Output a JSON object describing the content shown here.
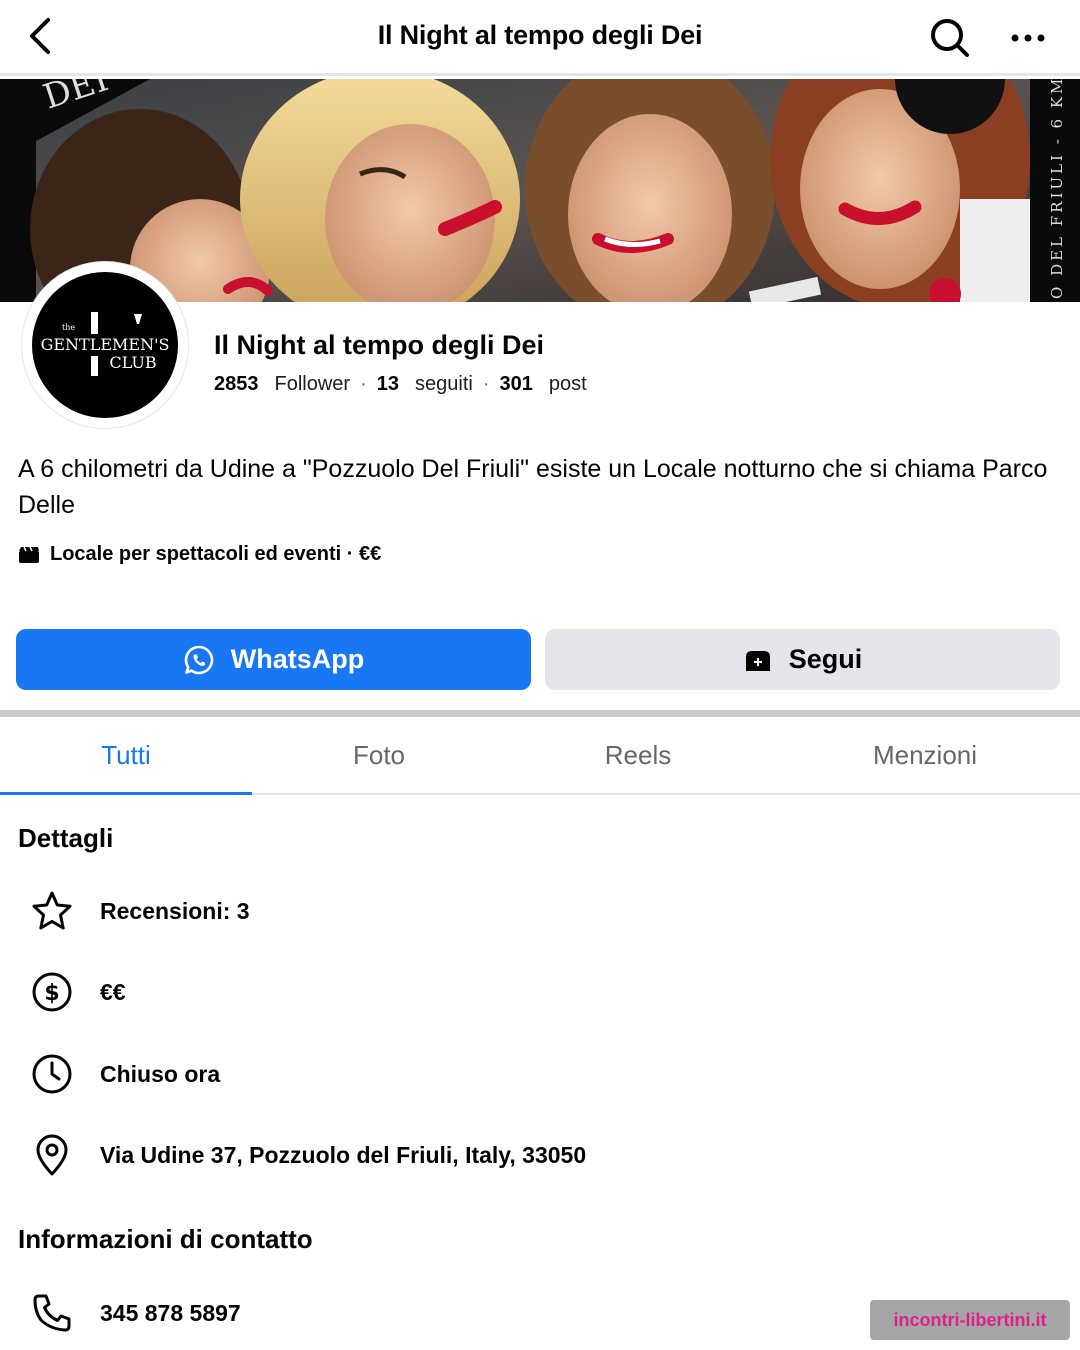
{
  "topbar": {
    "title": "Il Night al tempo degli Dei"
  },
  "cover": {
    "banner_left_text": "DEI",
    "banner_right_text": "O DEL FRIULI - 6 KM"
  },
  "profile": {
    "avatar_line1": "the",
    "avatar_line2": "GENTLEMEN'S",
    "avatar_line3": "CLUB",
    "name": "Il Night al tempo degli Dei",
    "followers_count": "2853",
    "followers_label": "Follower",
    "following_count": "13",
    "following_label": "seguiti",
    "posts_count": "301",
    "posts_label": "post",
    "separator": "·",
    "description": "A 6 chilometri da Udine a \"Pozzuolo Del Friuli\" esiste un Locale notturno che si chiama Parco Delle",
    "category": "Locale per spettacoli ed eventi · €€"
  },
  "actions": {
    "whatsapp_label": "WhatsApp",
    "follow_label": "Segui"
  },
  "tabs": [
    {
      "label": "Tutti",
      "active": true
    },
    {
      "label": "Foto",
      "active": false
    },
    {
      "label": "Reels",
      "active": false
    },
    {
      "label": "Menzioni",
      "active": false
    }
  ],
  "details": {
    "heading": "Dettagli",
    "reviews": "Recensioni: 3",
    "price": "€€",
    "hours": "Chiuso ora",
    "address": "Via Udine 37, Pozzuolo del Friuli, Italy, 33050"
  },
  "contact": {
    "heading": "Informazioni di contatto",
    "phone": "345 878 5897"
  },
  "watermark": "incontri-libertini.it",
  "colors": {
    "accent": "#1877f2",
    "button_secondary": "#e4e6eb",
    "watermark_text": "#e0208a"
  }
}
